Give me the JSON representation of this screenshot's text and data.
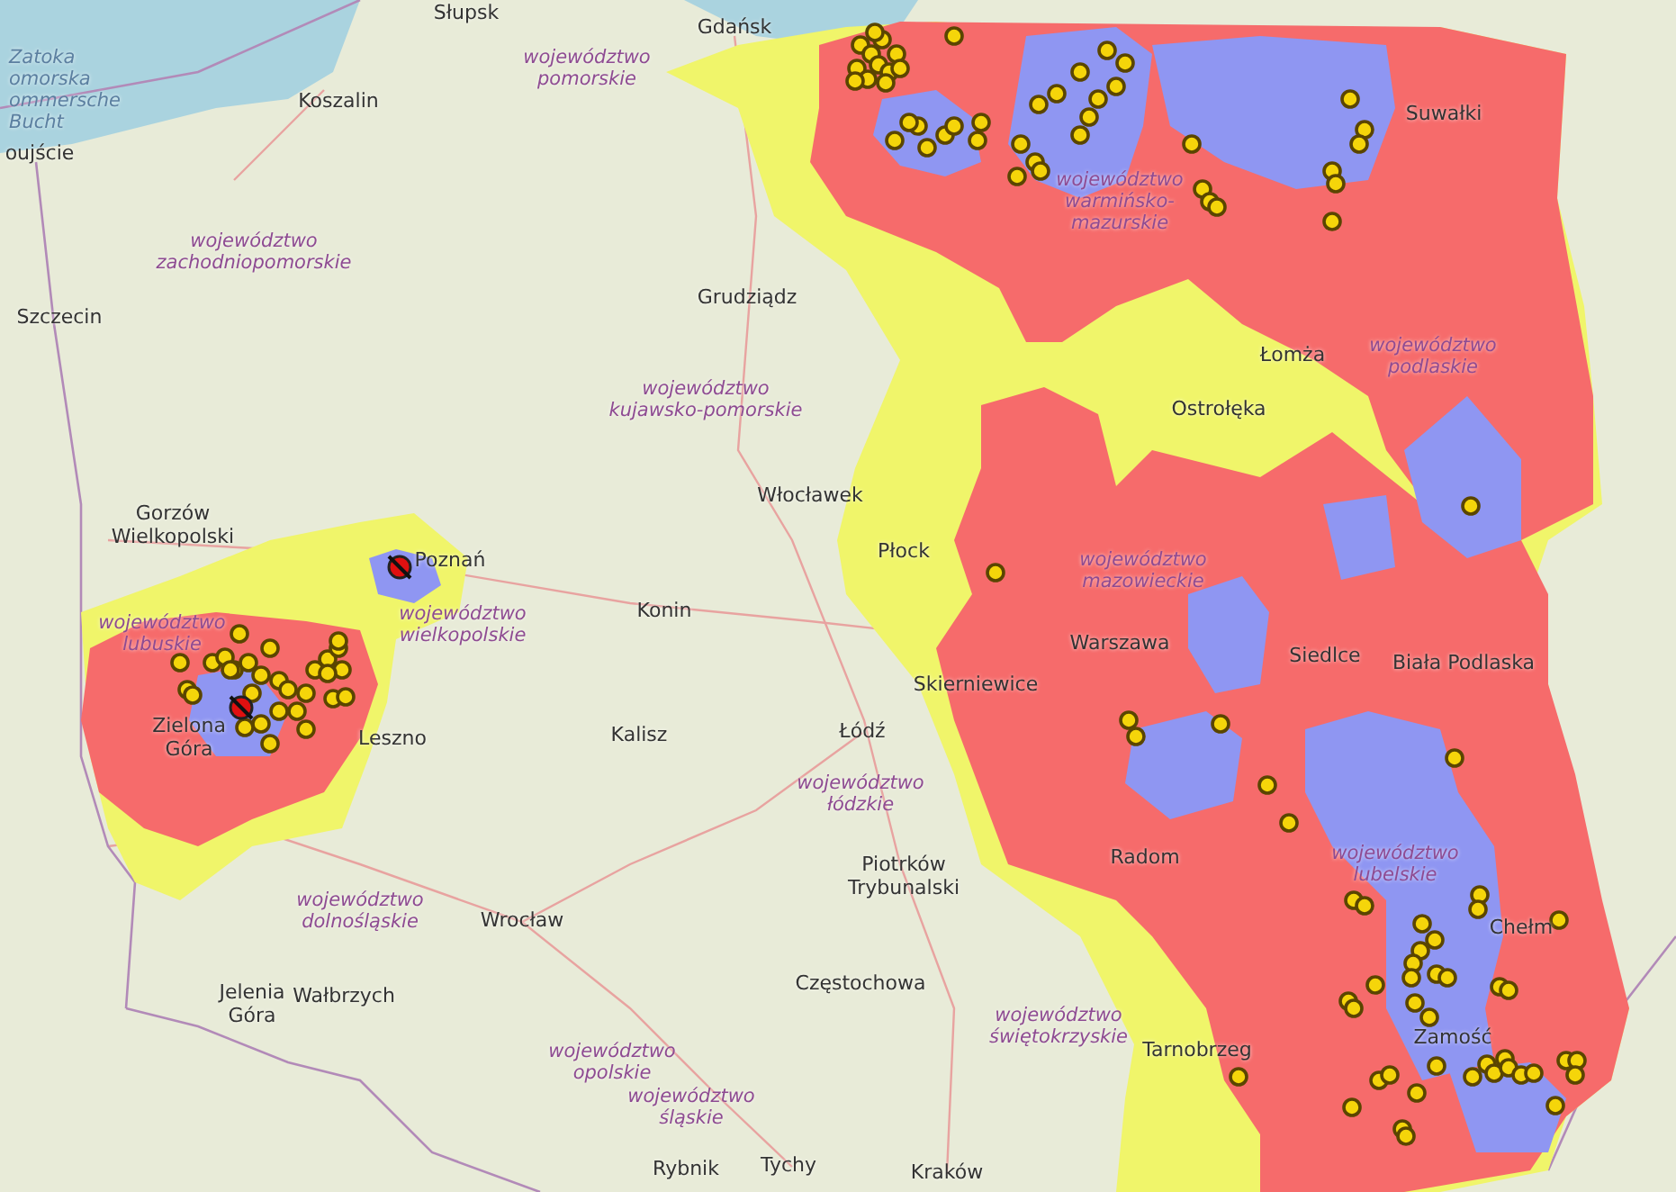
{
  "map": {
    "sea_labels": [
      "Zatoka\nomorska\nommersche\nBucht"
    ],
    "cities": [
      "Słupsk",
      "Koszalin",
      "oujście",
      "Szczecin",
      "Gdańsk",
      "Grudziądz",
      "Suwałki",
      "Łomża",
      "Ostrołęka",
      "Gorzów\nWielkopolski",
      "Poznań",
      "Włocławek",
      "Płock",
      "Konin",
      "Warszawa",
      "Siedlce",
      "Biała Podlaska",
      "Skierniewice",
      "Zielona\nGóra",
      "Leszno",
      "Kalisz",
      "Łódź",
      "Piotrków\nTrybunalski",
      "Radom",
      "Chełm",
      "Wrocław",
      "Jelenia\nGóra",
      "Wałbrzych",
      "Częstochowa",
      "Tarnobrzeg",
      "Zamość",
      "Rybnik",
      "Tychy",
      "Kraków"
    ],
    "regions": [
      "województwo\npomorskie",
      "województwo\nzachodniopomorskie",
      "województwo\nwarmińsko-\nmazurskie",
      "województwo\npodlaskie",
      "województwo\nkujawsko-pomorskie",
      "województwo\nmazowieckie",
      "województwo\nlubuskie",
      "województwo\nwielkopolskie",
      "województwo\nłódzkie",
      "województwo\nlubelskie",
      "województwo\ndolnośląskie",
      "województwo\nopolskie",
      "województwo\nświętokrzyskie",
      "województwo\nśląskie"
    ],
    "zones": [
      {
        "color": "#f0f56a"
      },
      {
        "color": "#f66b6b"
      },
      {
        "color": "#8f96f2"
      }
    ]
  }
}
